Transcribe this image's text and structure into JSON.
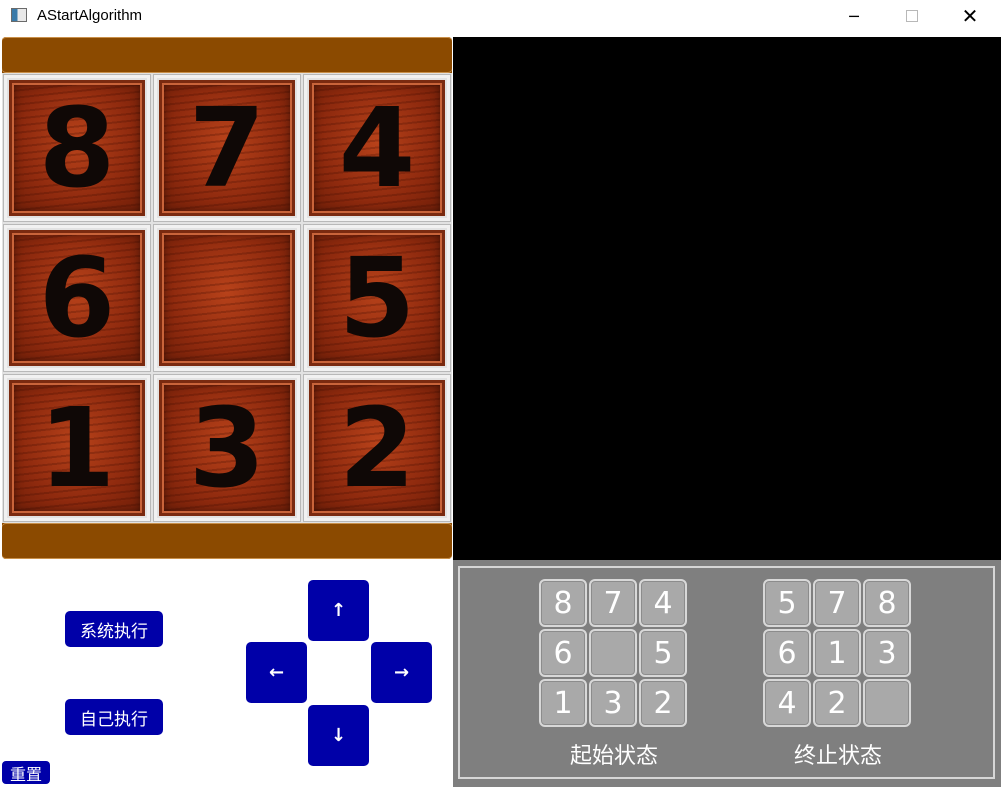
{
  "window": {
    "title": "AStartAlgorithm",
    "minimize_glyph": "─",
    "close_glyph": "✕",
    "icon": "app-window-icon"
  },
  "board": {
    "tiles": [
      "8",
      "7",
      "4",
      "6",
      "",
      "5",
      "1",
      "3",
      "2"
    ]
  },
  "controls": {
    "system_run_label": "系统执行",
    "self_run_label": "自己执行",
    "reset_label": "重置",
    "arrow_up": "↑",
    "arrow_down": "↓",
    "arrow_left": "←",
    "arrow_right": "→"
  },
  "start_state": {
    "label": "起始状态",
    "tiles": [
      "8",
      "7",
      "4",
      "6",
      "",
      "5",
      "1",
      "3",
      "2"
    ]
  },
  "goal_state": {
    "label": "终止状态",
    "tiles": [
      "5",
      "7",
      "8",
      "6",
      "1",
      "3",
      "4",
      "2",
      ""
    ]
  },
  "colors": {
    "button_blue": "#0000a8",
    "board_brown": "#8b4a00",
    "state_panel_gray": "#7f7f7f"
  }
}
